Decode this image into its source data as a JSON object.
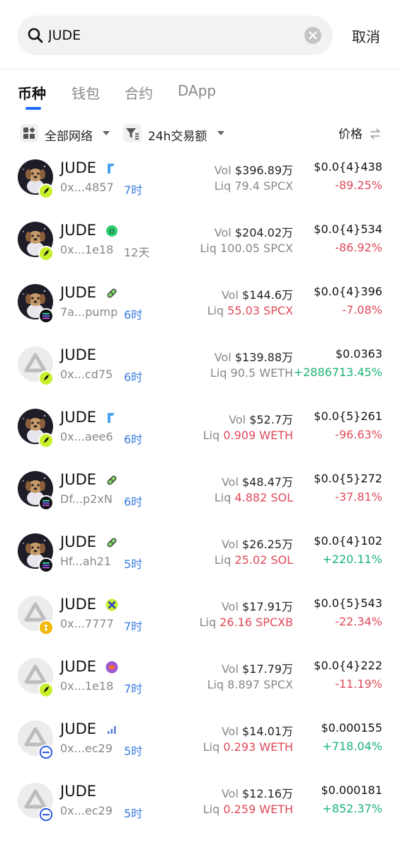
{
  "search": {
    "query": "JUDE",
    "cancel_label": "取消"
  },
  "tabs": [
    {
      "label": "币种",
      "active": true
    },
    {
      "label": "钱包",
      "active": false
    },
    {
      "label": "合约",
      "active": false
    },
    {
      "label": "DApp",
      "active": false
    }
  ],
  "filters": {
    "network_label": "全部网络",
    "sort_label": "24h交易额",
    "price_label": "价格"
  },
  "colors": {
    "accent": "#1f6bff",
    "negative": "#e04a59",
    "positive": "#1cb377",
    "age_blue": "#3a7be0"
  },
  "tokens": [
    {
      "name": "JUDE",
      "tag_icon": "flag-icon",
      "address": "0x...4857",
      "age": "7时",
      "vol_label": "Vol",
      "vol": "$396.89万",
      "liq_label": "Liq",
      "liq": "79.4 SPCX",
      "price": "$0.0{4}438",
      "change": "-89.25%",
      "chain": "spcx"
    },
    {
      "name": "JUDE",
      "tag_icon": "green-circle-icon",
      "address": "0x...1e18",
      "age": "12天",
      "vol_label": "Vol",
      "vol": "$204.02万",
      "liq_label": "Liq",
      "liq": "100.05 SPCX",
      "price": "$0.0{4}534",
      "change": "-86.92%",
      "chain": "spcx"
    },
    {
      "name": "JUDE",
      "tag_icon": "pill-icon",
      "address": "7a...pump",
      "age": "6时",
      "vol_label": "Vol",
      "vol": "$144.6万",
      "liq_label": "Liq",
      "liq": "55.03 SPCX",
      "price": "$0.0{4}396",
      "change": "-7.08%",
      "chain": "sol"
    },
    {
      "name": "JUDE",
      "tag_icon": "",
      "address": "0x...cd75",
      "age": "6时",
      "vol_label": "Vol",
      "vol": "$139.88万",
      "liq_label": "Liq",
      "liq": "90.5 WETH",
      "price": "$0.0363",
      "change": "+2886713.45%",
      "chain": "spcx"
    },
    {
      "name": "JUDE",
      "tag_icon": "flag-icon",
      "address": "0x...aee6",
      "age": "6时",
      "vol_label": "Vol",
      "vol": "$52.7万",
      "liq_label": "Liq",
      "liq": "0.909 WETH",
      "price": "$0.0{5}261",
      "change": "-96.63%",
      "chain": "spcx"
    },
    {
      "name": "JUDE",
      "tag_icon": "pill-icon",
      "address": "Df...p2xN",
      "age": "6时",
      "vol_label": "Vol",
      "vol": "$48.47万",
      "liq_label": "Liq",
      "liq": "4.882 SOL",
      "price": "$0.0{5}272",
      "change": "-37.81%",
      "chain": "sol"
    },
    {
      "name": "JUDE",
      "tag_icon": "pill-icon",
      "address": "Hf...ah21",
      "age": "5时",
      "vol_label": "Vol",
      "vol": "$26.25万",
      "liq_label": "Liq",
      "liq": "25.02 SOL",
      "price": "$0.0{4}102",
      "change": "+220.11%",
      "chain": "sol"
    },
    {
      "name": "JUDE",
      "tag_icon": "x-badge-icon",
      "address": "0x...7777",
      "age": "7时",
      "vol_label": "Vol",
      "vol": "$17.91万",
      "liq_label": "Liq",
      "liq": "26.16 SPCXB",
      "price": "$0.0{5}543",
      "change": "-22.34%",
      "chain": "bnb"
    },
    {
      "name": "JUDE",
      "tag_icon": "purple-box-icon",
      "address": "0x...1e18",
      "age": "7时",
      "vol_label": "Vol",
      "vol": "$17.79万",
      "liq_label": "Liq",
      "liq": "8.897 SPCX",
      "price": "$0.0{4}222",
      "change": "-11.19%",
      "chain": "spcx"
    },
    {
      "name": "JUDE",
      "tag_icon": "signal-bars-icon",
      "address": "0x...ec29",
      "age": "5时",
      "vol_label": "Vol",
      "vol": "$14.01万",
      "liq_label": "Liq",
      "liq": "0.293 WETH",
      "price": "$0.000155",
      "change": "+718.04%",
      "chain": "base"
    },
    {
      "name": "JUDE",
      "tag_icon": "",
      "address": "0x...ec29",
      "age": "5时",
      "vol_label": "Vol",
      "vol": "$12.16万",
      "liq_label": "Liq",
      "liq": "0.259 WETH",
      "price": "$0.000181",
      "change": "+852.37%",
      "chain": "base"
    }
  ]
}
